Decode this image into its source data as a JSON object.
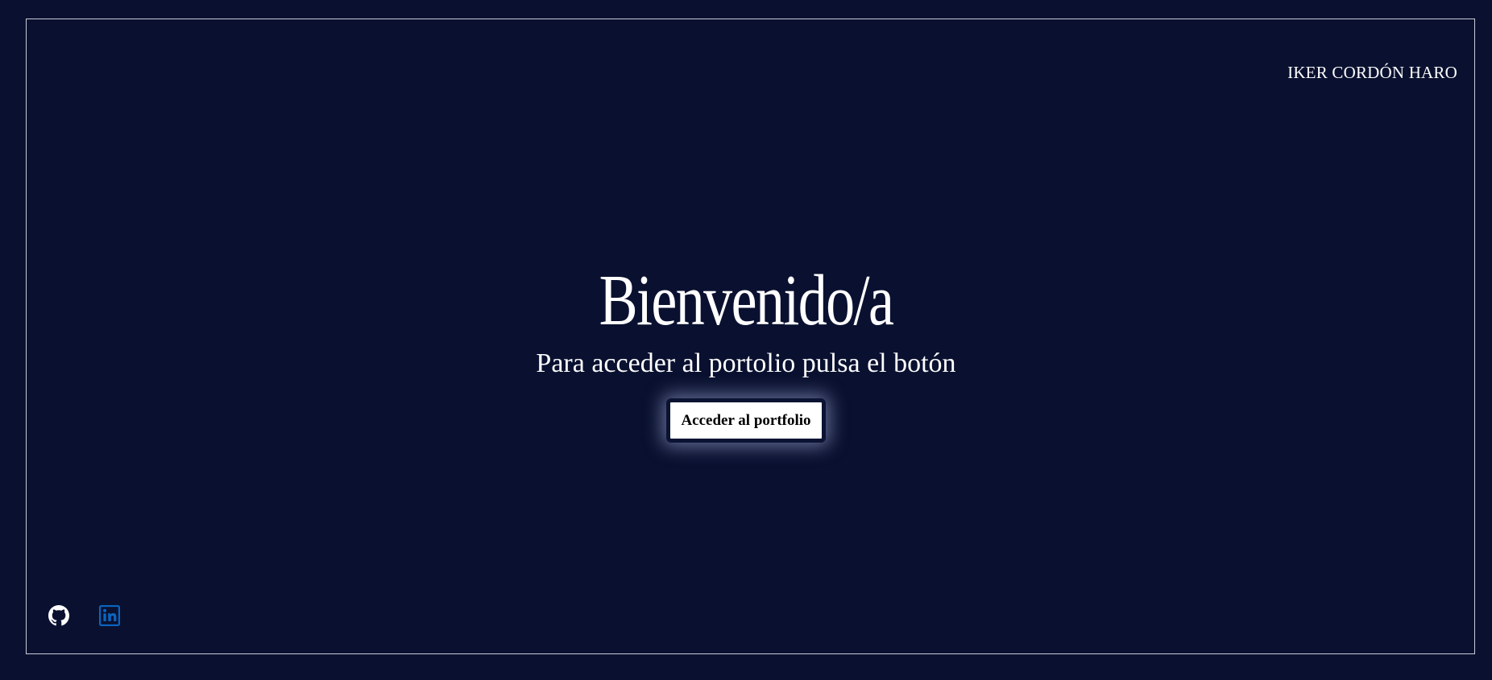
{
  "header": {
    "author_name": "IKER CORDÓN HARO"
  },
  "hero": {
    "title": "Bienvenido/a",
    "subtitle": "Para acceder al portolio pulsa el botón",
    "button_label": "Acceder al portfolio"
  },
  "social": {
    "links": [
      {
        "name": "github",
        "icon": "github-icon",
        "color": "#ffffff"
      },
      {
        "name": "linkedin",
        "icon": "linkedin-icon",
        "color": "#0a66c2"
      }
    ]
  },
  "colors": {
    "background": "#0a1130",
    "frame_border": "#c8cbd6",
    "text": "#ffffff",
    "button_background": "#ffffff",
    "button_text": "#000000"
  }
}
